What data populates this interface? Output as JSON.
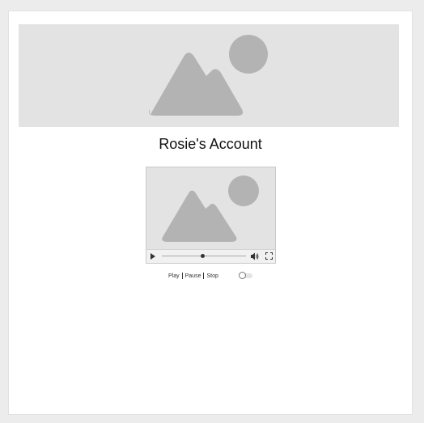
{
  "profile": {
    "title": "Rosie's Account"
  },
  "media": {
    "banner_icon": "image-placeholder-icon",
    "poster_icon": "image-placeholder-icon",
    "progress": 0.5
  },
  "playback_links": {
    "play": "Play",
    "pause": "Pause",
    "stop": "Stop"
  },
  "colors": {
    "placeholder_bg": "#e3e3e3",
    "placeholder_shape": "#b3b3b3"
  }
}
